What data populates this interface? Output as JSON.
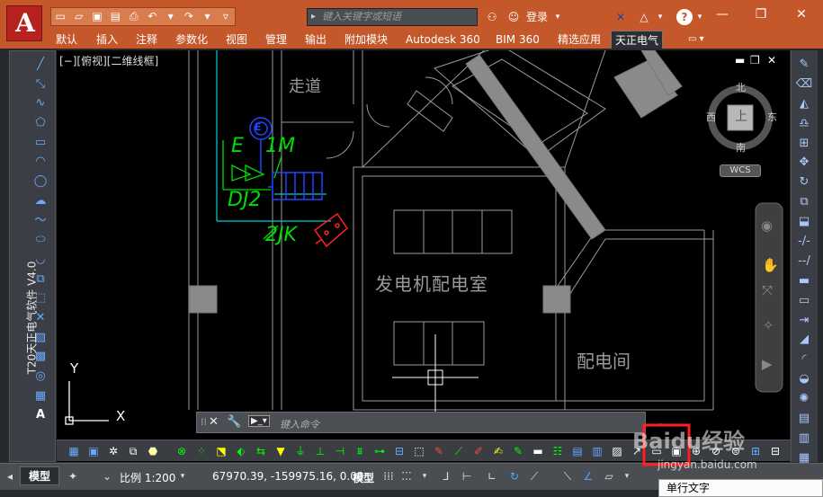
{
  "app": {
    "logo": "A"
  },
  "titlebar": {
    "search_placeholder": "键入关键字或短语",
    "login_label": "登录",
    "help_label": "?"
  },
  "ribbon_tabs": [
    {
      "label": "默认"
    },
    {
      "label": "插入"
    },
    {
      "label": "注释"
    },
    {
      "label": "参数化"
    },
    {
      "label": "视图"
    },
    {
      "label": "管理"
    },
    {
      "label": "输出"
    },
    {
      "label": "附加模块"
    },
    {
      "label": "Autodesk 360"
    },
    {
      "label": "BIM 360"
    },
    {
      "label": "精选应用"
    },
    {
      "label": "天正电气"
    }
  ],
  "side_palette": {
    "title": "T20天正电气软件 V4.0"
  },
  "viewport": {
    "label": "[−][俯视][二维线框]",
    "viewcube": {
      "north": "北",
      "south": "南",
      "east": "东",
      "west": "西",
      "top": "上",
      "wcs": "WCS"
    },
    "drawing_texts": {
      "corridor": "走道",
      "generator_room": "发电机配电室",
      "distribution_room": "配电间",
      "e_label": "E",
      "m_label": "1M",
      "dj2_label": "DJ2",
      "jk_label": "2JK",
      "circle_label": "E"
    },
    "ucs": {
      "x": "X",
      "y": "Y"
    }
  },
  "command_line": {
    "prompt": "键入命令"
  },
  "status_bar": {
    "layout_tab": "模型",
    "scale": "比例 1:200",
    "coordinates": "67970.39, -159975.16, 0.00",
    "space": "模型"
  },
  "tooltip": {
    "text": "单行文字"
  },
  "watermark": {
    "text": "Baidu经验",
    "url": "jingyan.baidu.com"
  },
  "colors": {
    "title_bar": "#c5582b",
    "green_text": "#00dd00",
    "cyan_line": "#00d0d0",
    "blue_symbol": "#2244ff",
    "red_symbol": "#ff2020"
  }
}
